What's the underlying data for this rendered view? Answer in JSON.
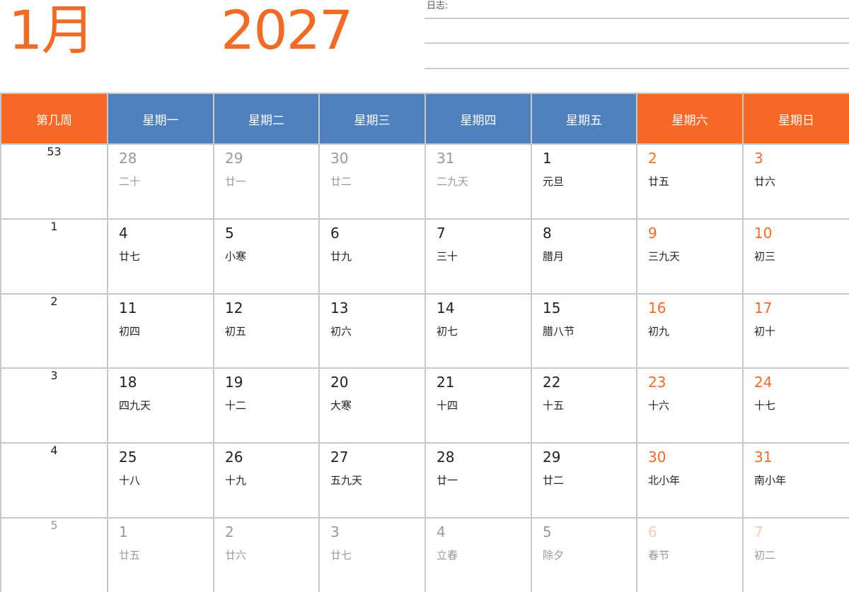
{
  "header": {
    "month": "1月",
    "year": "2027",
    "notes_label": "日志:"
  },
  "columns": [
    "第几周",
    "星期一",
    "星期二",
    "星期三",
    "星期四",
    "星期五",
    "星期六",
    "星期日"
  ],
  "weeks": [
    {
      "num": "53",
      "days": [
        {
          "d": "28",
          "l": "二十",
          "other": true
        },
        {
          "d": "29",
          "l": "廿一",
          "other": true
        },
        {
          "d": "30",
          "l": "廿二",
          "other": true
        },
        {
          "d": "31",
          "l": "二九天",
          "other": true
        },
        {
          "d": "1",
          "l": "元旦",
          "other": false
        },
        {
          "d": "2",
          "l": "廿五",
          "other": false
        },
        {
          "d": "3",
          "l": "廿六",
          "other": false
        }
      ]
    },
    {
      "num": "1",
      "days": [
        {
          "d": "4",
          "l": "廿七",
          "other": false
        },
        {
          "d": "5",
          "l": "小寒",
          "other": false
        },
        {
          "d": "6",
          "l": "廿九",
          "other": false
        },
        {
          "d": "7",
          "l": "三十",
          "other": false
        },
        {
          "d": "8",
          "l": "腊月",
          "other": false
        },
        {
          "d": "9",
          "l": "三九天",
          "other": false
        },
        {
          "d": "10",
          "l": "初三",
          "other": false
        }
      ]
    },
    {
      "num": "2",
      "days": [
        {
          "d": "11",
          "l": "初四",
          "other": false
        },
        {
          "d": "12",
          "l": "初五",
          "other": false
        },
        {
          "d": "13",
          "l": "初六",
          "other": false
        },
        {
          "d": "14",
          "l": "初七",
          "other": false
        },
        {
          "d": "15",
          "l": "腊八节",
          "other": false
        },
        {
          "d": "16",
          "l": "初九",
          "other": false
        },
        {
          "d": "17",
          "l": "初十",
          "other": false
        }
      ]
    },
    {
      "num": "3",
      "days": [
        {
          "d": "18",
          "l": "四九天",
          "other": false
        },
        {
          "d": "19",
          "l": "十二",
          "other": false
        },
        {
          "d": "20",
          "l": "大寒",
          "other": false
        },
        {
          "d": "21",
          "l": "十四",
          "other": false
        },
        {
          "d": "22",
          "l": "十五",
          "other": false
        },
        {
          "d": "23",
          "l": "十六",
          "other": false
        },
        {
          "d": "24",
          "l": "十七",
          "other": false
        }
      ]
    },
    {
      "num": "4",
      "days": [
        {
          "d": "25",
          "l": "十八",
          "other": false
        },
        {
          "d": "26",
          "l": "十九",
          "other": false
        },
        {
          "d": "27",
          "l": "五九天",
          "other": false
        },
        {
          "d": "28",
          "l": "廿一",
          "other": false
        },
        {
          "d": "29",
          "l": "廿二",
          "other": false
        },
        {
          "d": "30",
          "l": "北小年",
          "other": false
        },
        {
          "d": "31",
          "l": "南小年",
          "other": false
        }
      ]
    },
    {
      "num": "5",
      "dim": true,
      "days": [
        {
          "d": "1",
          "l": "廿五",
          "other": true
        },
        {
          "d": "2",
          "l": "廿六",
          "other": true
        },
        {
          "d": "3",
          "l": "廿七",
          "other": true
        },
        {
          "d": "4",
          "l": "立春",
          "other": true
        },
        {
          "d": "5",
          "l": "除夕",
          "other": true
        },
        {
          "d": "6",
          "l": "春节",
          "other": true
        },
        {
          "d": "7",
          "l": "初二",
          "other": true
        }
      ]
    }
  ],
  "colors": {
    "accent": "#f26a24",
    "header_orange": "#f76725",
    "header_blue": "#4e81bd",
    "dim_text": "#999999",
    "dim_weekend": "#f6cdb9"
  }
}
